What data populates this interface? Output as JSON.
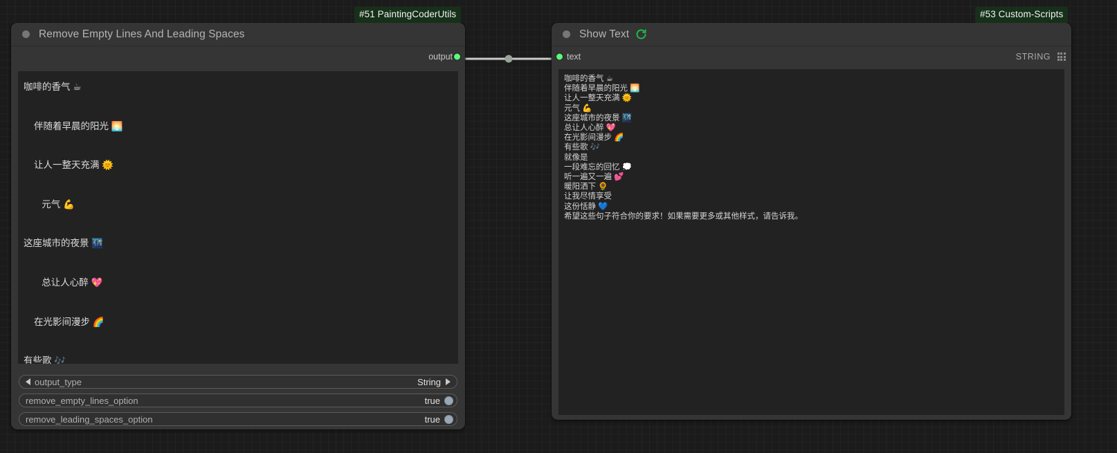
{
  "canvas": {
    "background_color": "#1b1b1b",
    "grid_color": "#262626"
  },
  "nodes": [
    {
      "badge": "#51 PaintingCoderUtils",
      "badge_color": "#163019",
      "title": "Remove Empty Lines And Leading Spaces",
      "title_dot_color": "#777777",
      "body_color": "#353535",
      "slots": {
        "output_label": "output",
        "output_dot_color": "#5afa7a"
      },
      "textbox_value": "咖啡的香气 ☕\n\n    伴随着早晨的阳光 🌅\n\n    让人一整天充满 🌞\n\n       元气 💪\n\n这座城市的夜景 🌃\n\n       总让人心醉 💖\n\n    在光影间漫步 🌈\n\n有些歌 🎶\n\n        就像是\n\n    一段难忘的回忆 💭\n\n       听一遍又一遍 💕\n\n暖阳洒下 🌻\n\n    让我尽情享受\n\n       这份恬静 💙\n\n希望这些句子符合你的要求！如果需要更多或其他样式，请告诉我。",
      "widgets": [
        {
          "name": "output_type",
          "label": "output_type",
          "value": "String",
          "type": "combo",
          "left_arrow": "◀",
          "right_arrow": "▶"
        },
        {
          "name": "remove_empty_lines_option",
          "label": "remove_empty_lines_option",
          "value": "true",
          "type": "toggle",
          "knob_color": "#9aa7b4"
        },
        {
          "name": "remove_leading_spaces_option",
          "label": "remove_leading_spaces_option",
          "value": "true",
          "type": "toggle",
          "knob_color": "#9aa7b4"
        }
      ]
    },
    {
      "badge": "#53 Custom-Scripts",
      "badge_color": "#163019",
      "title": "Show Text",
      "title_icon": "refresh-icon",
      "title_icon_color": "#19c24a",
      "title_dot_color": "#777777",
      "body_color": "#353535",
      "slots": {
        "input_label": "text",
        "input_dot_color": "#5afa7a",
        "input_type": "STRING",
        "input_type_icon": "dot-grid-icon"
      },
      "textbox_value": "咖啡的香气 ☕\n伴随着早晨的阳光 🌅\n让人一整天充满 🌞\n元气 💪\n这座城市的夜景 🌃\n总让人心醉 💖\n在光影间漫步 🌈\n有些歌 🎶\n就像是\n一段难忘的回忆 💭\n听一遍又一遍 💕\n暖阳洒下 🌻\n让我尽情享受\n这份恬静 💙\n希望这些句子符合你的要求！如果需要更多或其他样式，请告诉我。"
    }
  ],
  "link": {
    "color": "#c9cdc9",
    "midpoint_dot_color": "#9aa59a"
  }
}
